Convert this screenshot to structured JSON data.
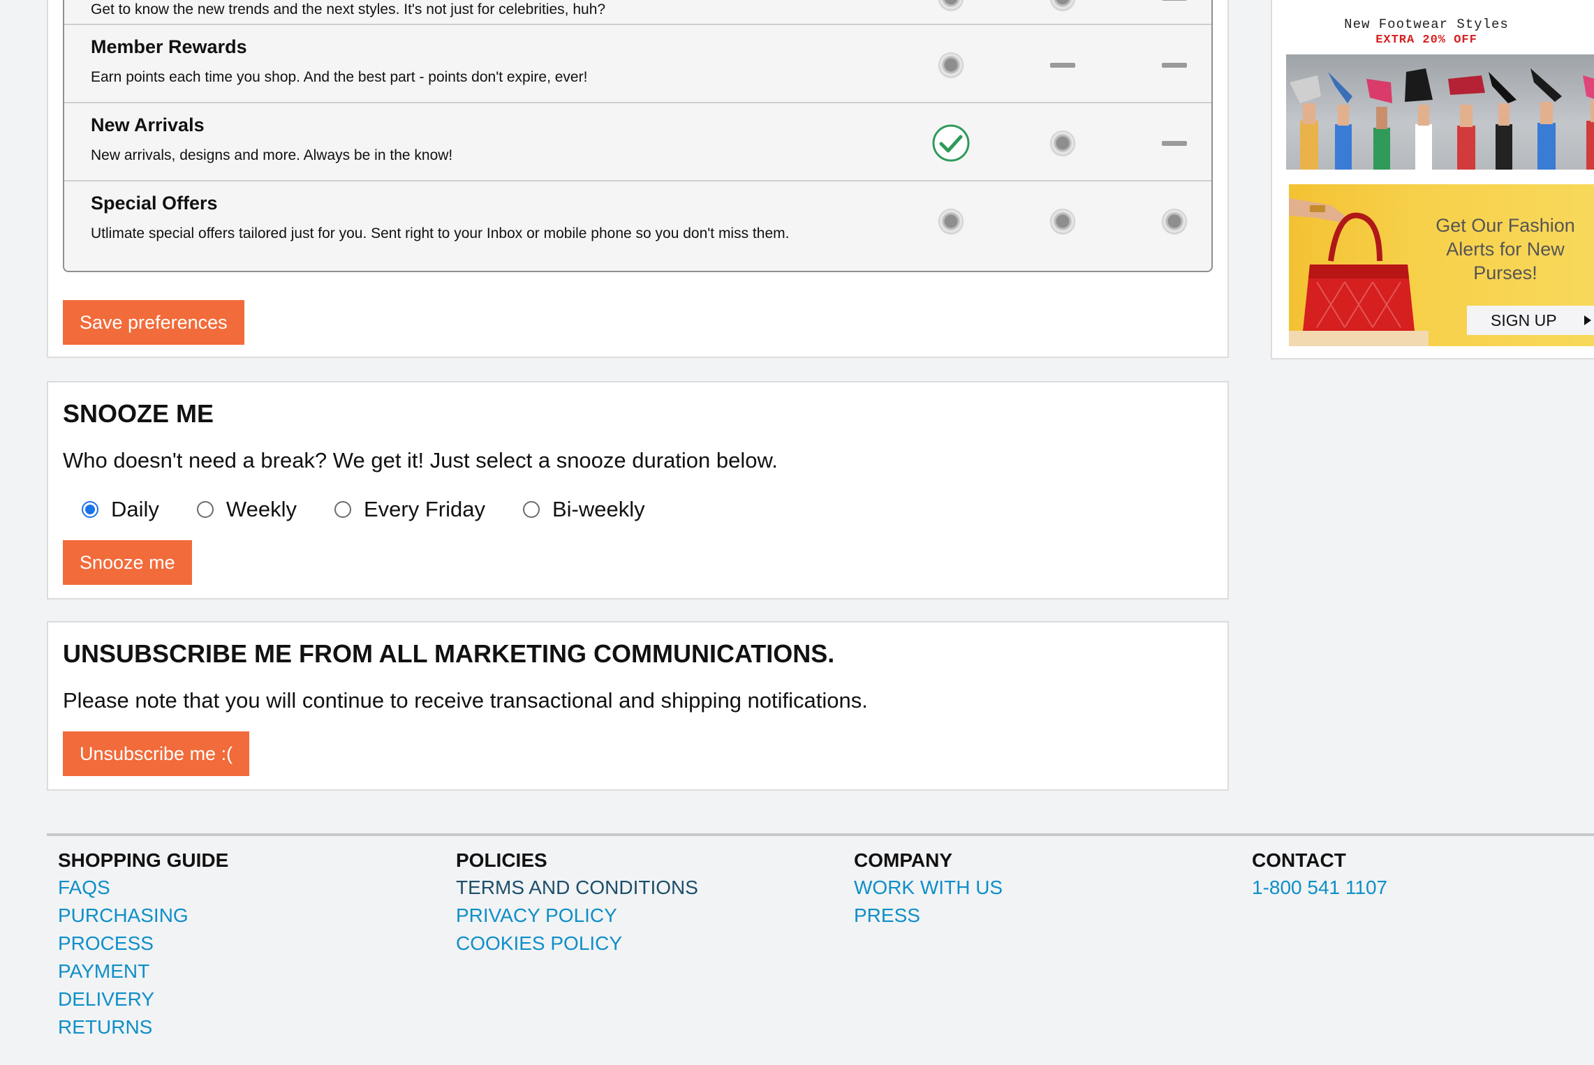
{
  "preferences": {
    "rows": [
      {
        "title": "",
        "description": "Get to know the new trends and the next styles. It's not just for celebrities, huh?",
        "cells": [
          "dot",
          "dot",
          "dash"
        ]
      },
      {
        "title": "Member Rewards",
        "description": "Earn points each time you shop. And the best part - points don't expire, ever!",
        "cells": [
          "dot",
          "dash",
          "dash"
        ]
      },
      {
        "title": "New Arrivals",
        "description": "New arrivals, designs and more. Always be in the know!",
        "cells": [
          "check",
          "dot",
          "dash"
        ]
      },
      {
        "title": "Special Offers",
        "description": "Utlimate special offers tailored just for you. Sent right to your Inbox or mobile phone so you don't miss them.",
        "cells": [
          "dot",
          "dot",
          "dot"
        ]
      }
    ],
    "save_label": "Save preferences"
  },
  "snooze": {
    "heading": "SNOOZE ME",
    "text": "Who doesn't need a break? We get it! Just select a snooze duration below.",
    "options": [
      {
        "label": "Daily",
        "checked": true
      },
      {
        "label": "Weekly",
        "checked": false
      },
      {
        "label": "Every Friday",
        "checked": false
      },
      {
        "label": "Bi-weekly",
        "checked": false
      }
    ],
    "button_label": "Snooze me"
  },
  "unsubscribe": {
    "heading": "UNSUBSCRIBE ME FROM ALL MARKETING COMMUNICATIONS.",
    "text": "Please note that you will continue to receive transactional and shipping notifications.",
    "button_label": "Unsubscribe me :("
  },
  "ads": {
    "footwear": {
      "title": "New Footwear Styles",
      "subtitle": "EXTRA 20% OFF"
    },
    "purses": {
      "text": "Get Our Fashion Alerts for New Purses!",
      "button_label": "SIGN UP"
    }
  },
  "footer": {
    "columns": [
      {
        "heading": "SHOPPING GUIDE",
        "links": [
          "FAQS",
          "PURCHASING",
          "PROCESS",
          "PAYMENT",
          "DELIVERY",
          "RETURNS"
        ],
        "dark": false
      },
      {
        "heading": "POLICIES",
        "links": [
          "TERMS AND CONDITIONS",
          "PRIVACY POLICY",
          "COOKIES POLICY"
        ],
        "dark": false
      },
      {
        "heading": "COMPANY",
        "links": [
          "WORK WITH US",
          "PRESS"
        ],
        "dark": false
      },
      {
        "heading": "CONTACT",
        "links": [
          "1-800 541 1107"
        ],
        "dark": false
      }
    ]
  },
  "colors": {
    "accent_button": "#f26b3a",
    "link": "#0e8fc7",
    "radio_checked": "#1a73e8",
    "check_green": "#2e9a5a",
    "ad_red": "#d62020"
  }
}
